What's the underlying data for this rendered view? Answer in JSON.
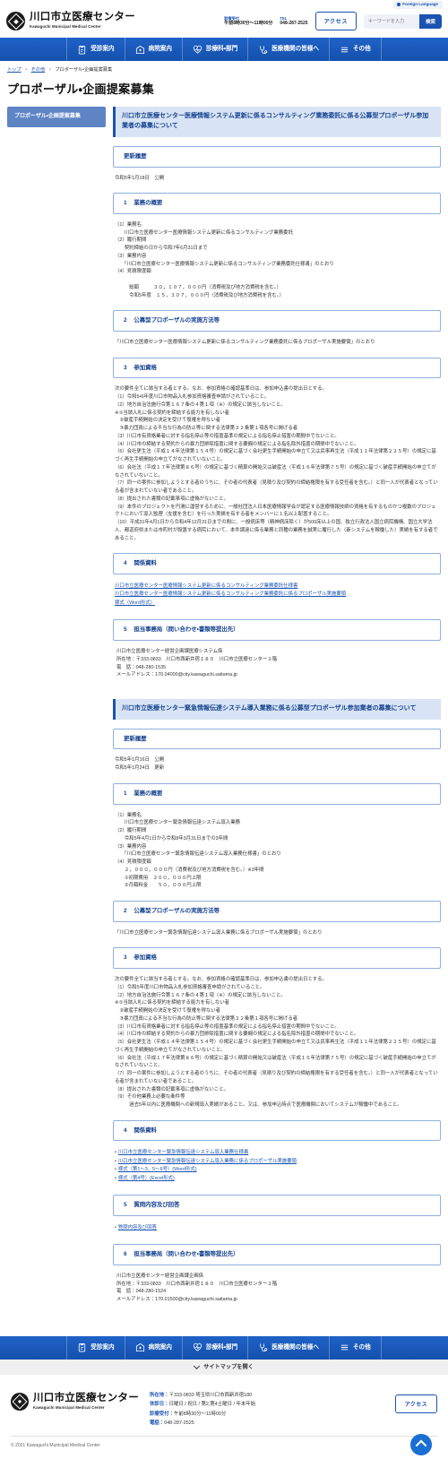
{
  "utility": {
    "language_label": "Foreign Language"
  },
  "header": {
    "logo_jp": "川口市立医療センター",
    "logo_en": "Kawaguchi Municipal Medical Center",
    "reception_label": "診療受付",
    "reception_value": "午前8時30分～11時00分",
    "tel_label": "TEL",
    "tel_value": "048-287-2525",
    "access_button": "アクセス",
    "search_placeholder": "キーワードを入力",
    "search_button": "検索"
  },
  "global_nav": [
    {
      "label": "受診案内",
      "icon": "clipboard-icon"
    },
    {
      "label": "病院案内",
      "icon": "hospital-icon"
    },
    {
      "label": "診療科・部門",
      "icon": "heart-pulse-icon"
    },
    {
      "label": "医療機関の皆様へ",
      "icon": "stethoscope-icon"
    },
    {
      "label": "その他",
      "icon": "hamburger-icon"
    }
  ],
  "breadcrumb": [
    {
      "label": "トップ",
      "link": true
    },
    {
      "label": "その他",
      "link": true
    },
    {
      "label": "プロポーザル・企画提案募集",
      "link": false
    }
  ],
  "page_title": "プロポーザル・企画提案募集",
  "sidebar": {
    "heading": "プロポーザル・企画提案募集"
  },
  "articles": [
    {
      "title": "川口市立医療センター医療情報システム更新に係るコンサルティング業務委託に係る公募型プロポーザル参加業者の募集について",
      "history_heading": "更新履歴",
      "history_body": "令和5年1月18日　公開",
      "sections": [
        {
          "num": "1",
          "heading": "業務の概要",
          "body": "（1）業務名\n　　川口市立医療センター医療情報システム更新に係るコンサルティング業務委託\n（2）履行期間\n　　契約締結の日から令和7年6月31日まで\n（3）業務内容\n　　「川口市立医療センター医療情報システム更新に係るコンサルティング業務委託仕様書」のとおり\n（4）見積限度額\n\n　　　総額　　　３０，１０７，０００円（消費税及び地方消費税を含む。）\n　　　令和5年度　１５，３０７，０００円（消費税及び地方消費税を含む。）"
        },
        {
          "num": "2",
          "heading": "公募型プロポーザルの実施方法等",
          "body": "「川口市立医療センター医療情報システム更新に係るコンサルティング業務委託に係るプロポーザル実施要領」のとおり"
        },
        {
          "num": "3",
          "heading": "参加資格",
          "body": "次の要件全てに該当する者とする。なお、参加資格の確認基準日は、参加申込書の提出日とする。\n（1）令和5・6年度川口市物品入札参加資格審査申請がされていること。\n（2）地方自治法施行令第１６７条の４第１項（※）の規定に該当しないこと。\n※①当該入札に係る契約を締結する能力を有しない者\n　②破産手続開始の決定を受けて復権を得ない者\n　③暴力団員による不当な行為の防止等に関する法律第３２条第１項各号に掲げる者\n（3）川口市有資格業者に対する指名停止等の措置基準の規定による指名停止措置の期間中でないこと。\n（4）川口市の締結する契約からの暴力団排除措置に関する要綱の規定による指名除外措置の期間中でないこと。\n（5）会社更生法（平成１４年法律第１５４号）の規定に基づく会社更生手続開始の申立て又は民事再生法（平成１１年法律第２２５号）の規定に基づく再生手続開始の申立てがなされていないこと。\n（6）会社法（平成１７年法律第８６号）の規定に基づく精算の開始又は破産法（平成１６年法律第７５号）の規定に基づく破産手続開始の申立てがなされていないこと。\n（7）同一の案件に参加しようとする者のうちに、その者の代表者（見積り及び契約の締結権限を有する受任者を含む。）と同一人が代表者となっている者が含まれていない者であること。\n（8）提出された書類の記載事項に虚偽がないこと。\n（9）本件のプロジェクトを円滑に運営するために、一般社団法人日本医療情報学会が認定する医療情報技師の資格を有するものかつ複数のプロジェクトにおいて導入監理（支援を含む）を行った実績を有する者をメンバーに１名以上配置すること。\n（10）平成31年4月1日から令和4年12月31日までの間に、一般病床等（精神病床除く）が500床以上の国、独立行政法人国立病院機構、国立大学法人、都道府県または市町村が設置する病院において、本件調達に係る業務と同種の業務を誠実に履行した（新システムを稼働した）実績を有する者であること。"
        },
        {
          "num": "4",
          "heading": "関係資料",
          "links": [
            {
              "label": "川口市立医療センター医療情報システム更新に係るコンサルティング業務委託仕様書",
              "bullet": ""
            },
            {
              "label": "川口市立医療センター医療情報システム更新に係るコンサルティング業務委託に係るプロポーザル実施要領",
              "bullet": ""
            },
            {
              "label": "様式（Word形式）",
              "bullet": ""
            }
          ]
        },
        {
          "num": "5",
          "heading": "担当事務局（問い合わせ・書類等提出先）",
          "body": "川口市立医療センター経営企画課医療システム係\n所在地：〒333-0833　川口市西新井宿１８０　川口市立医療センター２階\n電　話：048-280-1535\nメールアドレス：170.04000@city.kawaguchi.saitama.jp"
        }
      ]
    },
    {
      "title": "川口市立医療センター緊急情報伝達システム導入業務に係る公募型プロポーザル参加業者の募集について",
      "history_heading": "更新履歴",
      "history_body": "令和5年1月16日　公開\n令和5年1月24日　更新",
      "sections": [
        {
          "num": "1",
          "heading": "業務の概要",
          "body": "（1）業務名\n　　川口市立医療センター緊急情報伝達システム導入業務\n（2）履行期間\n　　令和5年4月1日から令和8年3月31日までの3年間\n（3）業務内容\n　　「川口市立医療センター緊急情報伝達システム導入業務仕様書」のとおり\n（4）見積限度額\n　　２，０００，０００円（消費税及び地方消費税を含む。）※3年間\n　　①初期費用　２００，０００円上限\n　　②月額料金　　５０，０００円上限"
        },
        {
          "num": "2",
          "heading": "公募型プロポーザルの実施方法等",
          "body": "「川口市立医療センター緊急情報伝達システム導入業務に係るプロポーザル実施要領」のとおり"
        },
        {
          "num": "3",
          "heading": "参加資格",
          "body": "次の要件全てに該当する者とする。なお、参加資格の確認基準日は、参加申込書の提出日とする。\n（1）令和5年度川口市物品入札参加資格審査申請がされていること。\n（2）地方自治法施行令第１６７条の４第１項（※）の規定に該当しないこと。\n※①当該入札に係る契約を締結する能力を有しない者\n　②破産手続開始の決定を受けて復権を得ない者\n　③暴力団員による不当な行為の防止等に関する法律第３２条第１項各号に掲げる者\n（3）川口市有資格業者に対する指名停止等の措置基準の規定による指名停止措置の期間中でないこと。\n（4）川口市の締結する契約からの暴力団排除措置に関する要綱の規定による指名除外措置の期間中でないこと。\n（5）会社更生法（平成１４年法律第１５４号）の規定に基づく会社更生手続開始の申立て又は民事再生法（平成１１年法律第２２５号）の規定に基づく再生手続開始の申立てがなされていないこと。\n（6）会社法（平成１７年法律第８６号）の規定に基づく精算の開始又は破産法（平成１６年法律第７５号）の規定に基づく破産手続開始の申立てがなされていないこと。\n（7）同一の案件に参加しようとする者のうちに、その者の代表者（見積り及び契約の締結権限を有する受任者を含む。）と同一人が代表者となっている者が含まれていない者であること。\n（8）提出された書類の記載事項に虚偽がないこと。\n（9）その他業務上必要な条件等\n　　　過去5年以内に医療機関への新規導入実績があること。又は、参加申込時点で医療機関においてシステムが稼働中であること。"
        },
        {
          "num": "4",
          "heading": "関係資料",
          "links": [
            {
              "label": "川口市立医療センター緊急情報伝達システム導入業務仕様書",
              "bullet": "・"
            },
            {
              "label": "川口市立医療センター緊急情報伝達システム導入業務に係るプロポーザル実施要領",
              "bullet": "・"
            },
            {
              "label": "様式（第1～3、5～6号）(Word形式)",
              "bullet": "・"
            },
            {
              "label": "様式（第4号）(Excel形式)",
              "bullet": "・"
            }
          ]
        },
        {
          "num": "5",
          "heading": "質問内容及び回答",
          "links": [
            {
              "label": "質問内容及び回答",
              "bullet": "・"
            }
          ]
        },
        {
          "num": "6",
          "heading": "担当事務局（問い合わせ・書類等提出先）",
          "body": "川口市立医療センター経営企画課企画係\n所在地：〒333-0833　川口市西新井宿１８０　川口市立医療センター２階\n電　話：048-280-1524\nメールアドレス：170.01500@city.kawaguchi.saitama.jp"
        }
      ]
    }
  ],
  "sitemap": {
    "label": "サイトマップを開く"
  },
  "footer": {
    "logo_jp": "川口市立医療センター",
    "logo_en": "Kawaguchi Municipal Medical Center",
    "info": [
      {
        "key": "所在地：",
        "value": "〒333-0833 埼玉県川口市西新井宿180"
      },
      {
        "key": "休診日：",
        "value": "日曜日 / 祝日 / 第2,第4土曜日 / 年末年始"
      },
      {
        "key": "診療受付：",
        "value": "午前8時30分～11時00分"
      },
      {
        "key": "電話：",
        "value": "048-287-2525"
      }
    ],
    "access_button": "アクセス",
    "copyright": "© 2021 Kawaguchi Municipal Medical Center"
  }
}
